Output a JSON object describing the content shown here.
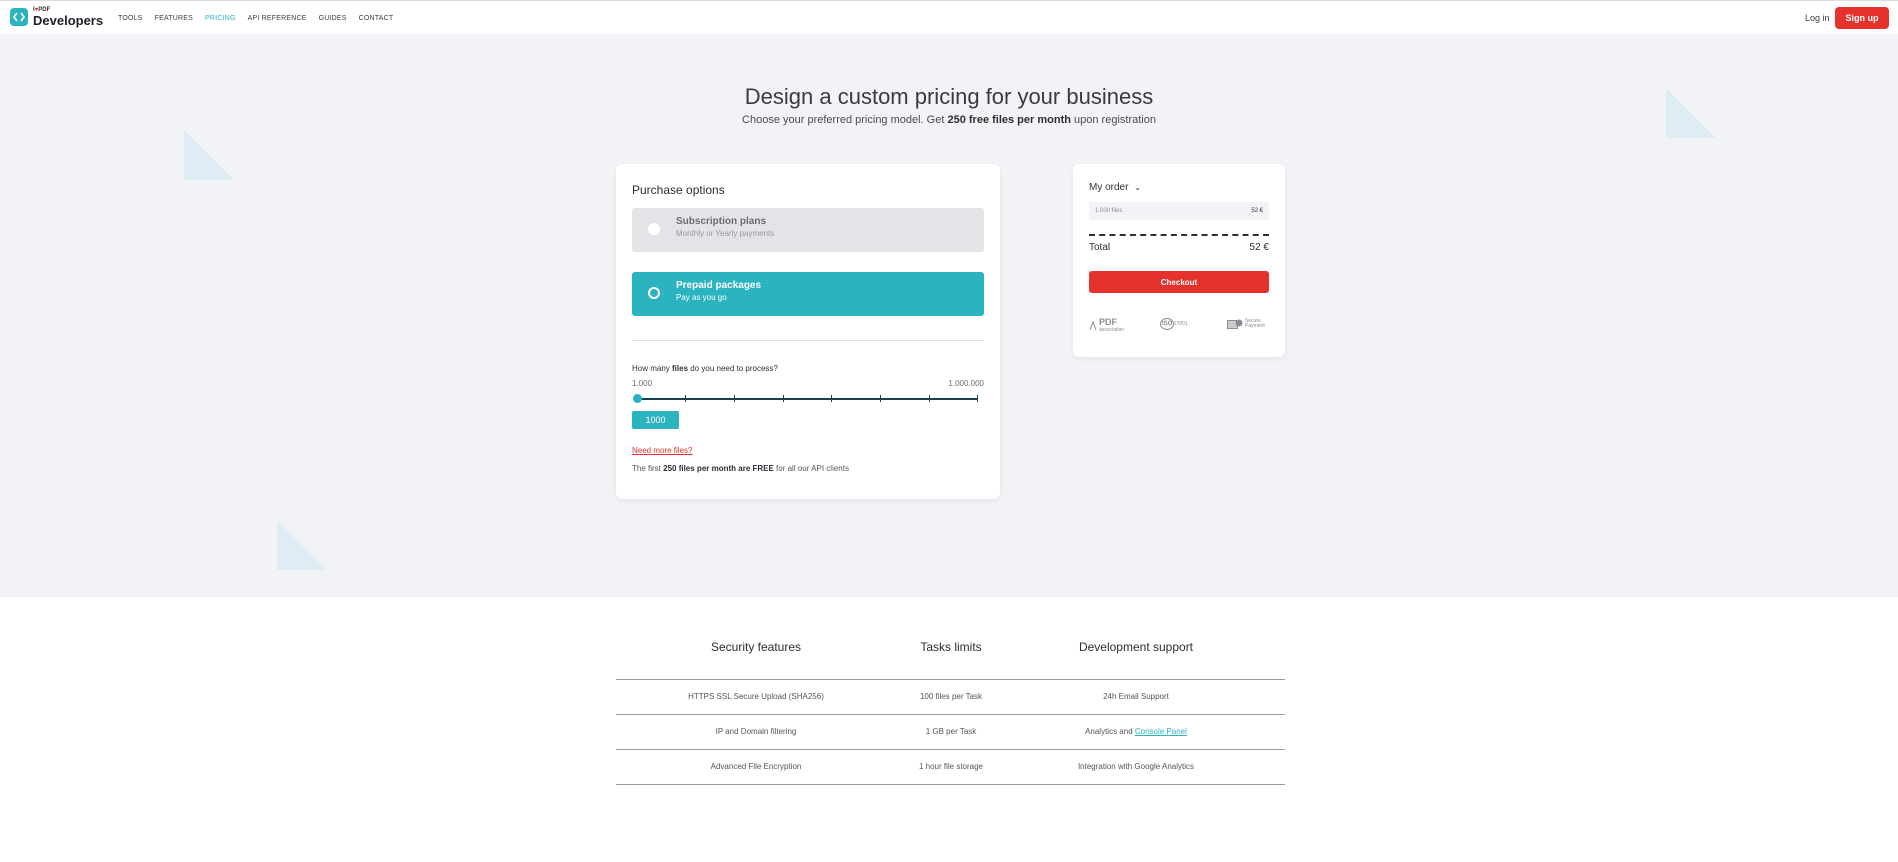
{
  "header": {
    "brand_top": "I♥PDF",
    "brand_name": "Developers",
    "nav": [
      "TOOLS",
      "FEATURES",
      "PRICING",
      "API REFERENCE",
      "GUIDES",
      "CONTACT"
    ],
    "active_nav": "PRICING",
    "login_label": "Log in",
    "signup_label": "Sign up"
  },
  "hero": {
    "title": "Design a custom pricing for your business",
    "subtitle_pre": "Choose your preferred pricing model. Get ",
    "subtitle_bold": "250 free files per month",
    "subtitle_post": " upon registration"
  },
  "purchase": {
    "title": "Purchase options",
    "options": [
      {
        "label": "Subscription plans",
        "desc": "Monthly or Yearly payments",
        "selected": false
      },
      {
        "label": "Prepaid packages",
        "desc": "Pay as you go",
        "selected": true
      }
    ],
    "question_pre": "How many ",
    "question_bold": "files",
    "question_post": " do you need to process?",
    "range_min": "1.000",
    "range_max": "1.000.000",
    "slider_value": "1000",
    "slider_fraction": 0,
    "need_more": "Need more files?",
    "free_pre": "The first ",
    "free_bold": "250 files per month are FREE",
    "free_post": " for all our API clients"
  },
  "order": {
    "title": "My order",
    "line_label": "1.000 files",
    "line_price": "52 €",
    "total_label": "Total",
    "total_value": "52 €",
    "checkout_label": "Checkout",
    "badges": [
      {
        "icon": "pdf-association-icon",
        "text": "PDF",
        "sub": "association"
      },
      {
        "icon": "iso-icon",
        "text": "ISO",
        "sub": "27001"
      },
      {
        "icon": "secure-payment-icon",
        "text": "Secure",
        "sub": "Payment"
      }
    ]
  },
  "features": {
    "columns": [
      "Security features",
      "Tasks limits",
      "Development support"
    ],
    "rows": [
      [
        "HTTPS SSL Secure Upload (SHA256)",
        "100 files per Task",
        "24h Email Support"
      ],
      [
        "IP and Domain filtering",
        "1 GB per Task",
        "Analytics and "
      ],
      [
        "Advanced File Encryption",
        "1 hour file storage",
        "Integration with Google Analytics"
      ]
    ],
    "console_link": "Console Panel"
  },
  "colors": {
    "accent": "#2bb3c0",
    "brand_red": "#e5322d",
    "hero_bg": "#f2f3f7"
  }
}
